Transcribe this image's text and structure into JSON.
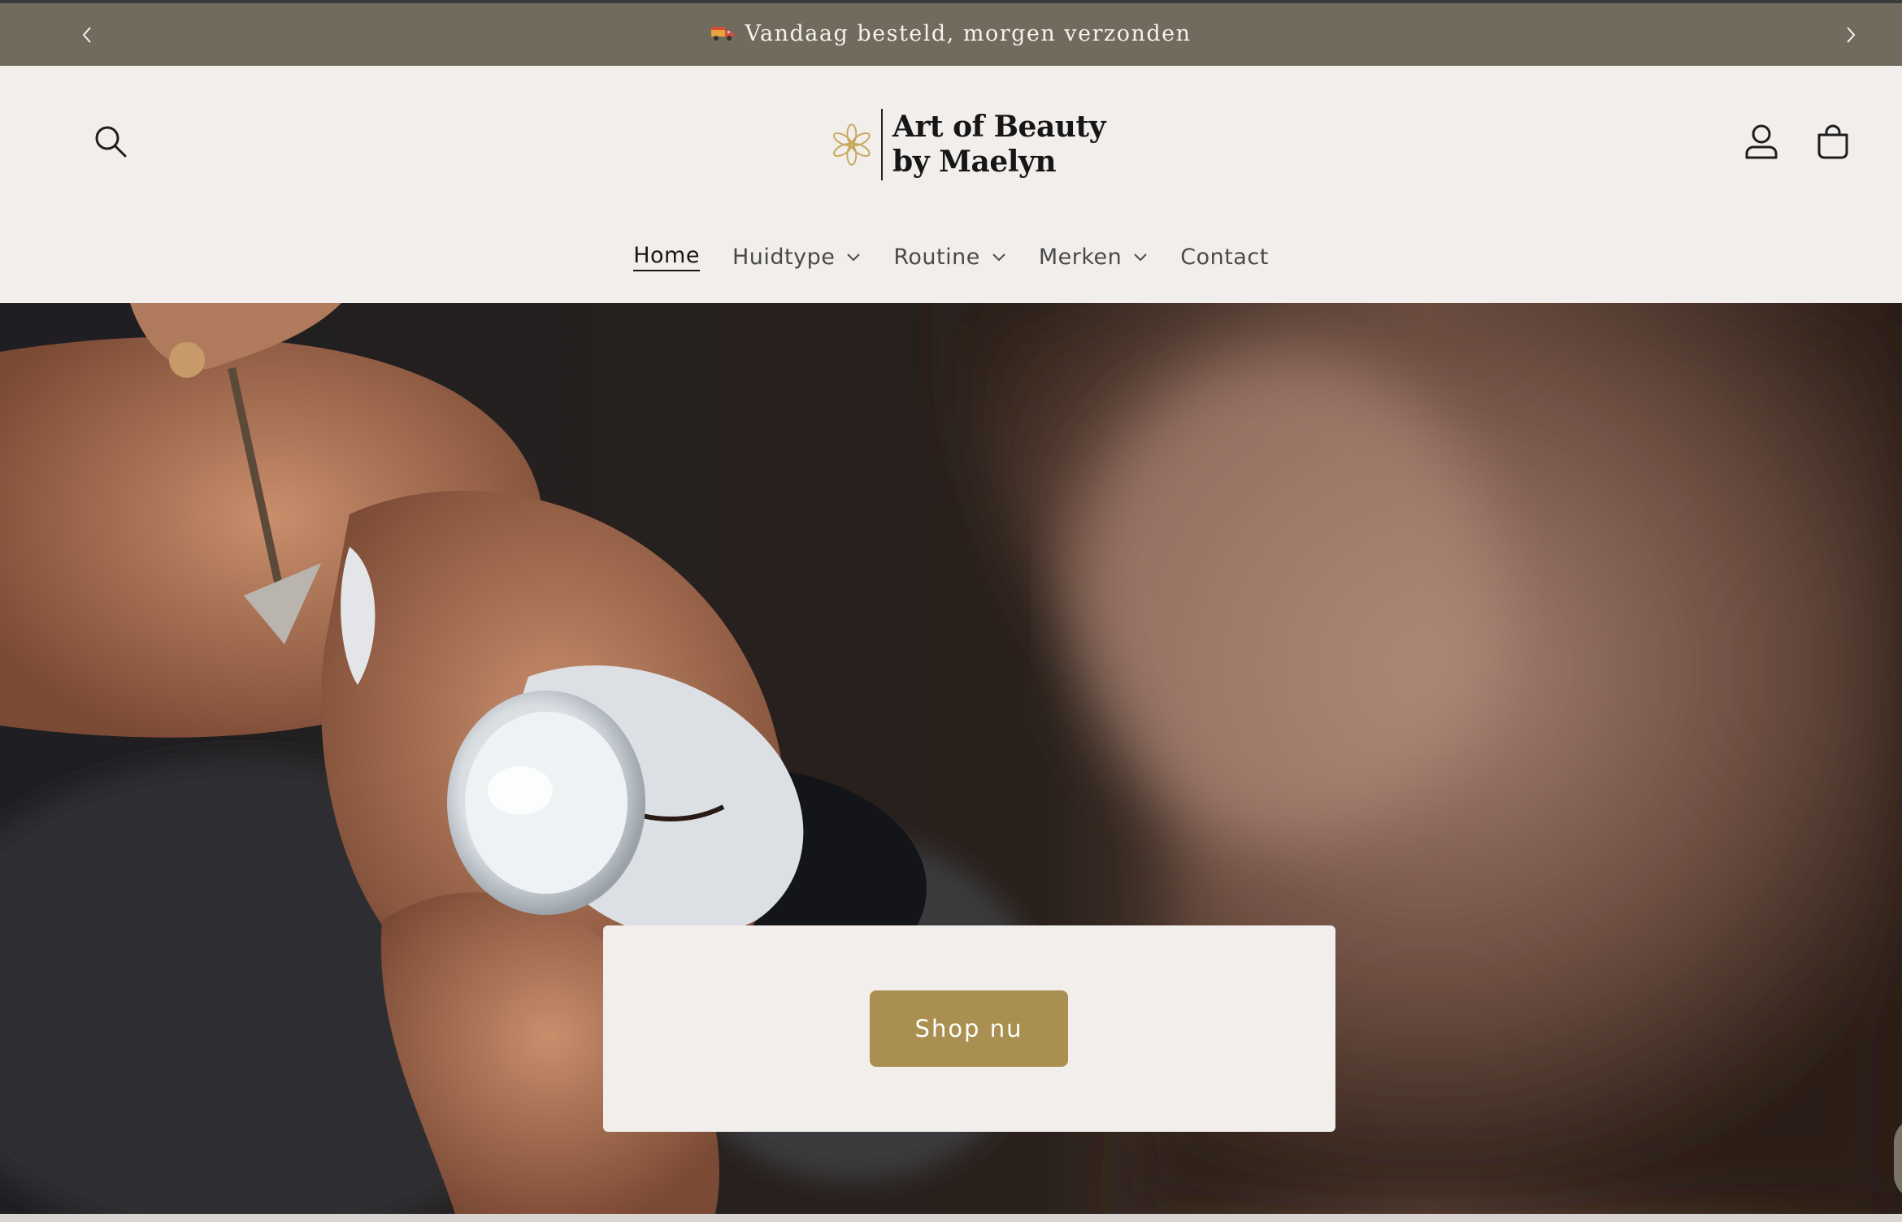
{
  "announcement": {
    "text": "Vandaag besteld, morgen verzonden",
    "icon": "truck-icon"
  },
  "header": {
    "search_icon": "search-icon",
    "account_icon": "account-icon",
    "cart_icon": "cart-icon",
    "logo": {
      "line1": "Art of Beauty",
      "line2": "by Maelyn",
      "mark_icon": "flower-icon"
    }
  },
  "nav": {
    "items": [
      {
        "label": "Home",
        "active": true
      },
      {
        "label": "Huidtype",
        "dropdown": true
      },
      {
        "label": "Routine",
        "dropdown": true
      },
      {
        "label": "Merken",
        "dropdown": true
      },
      {
        "label": "Contact"
      }
    ]
  },
  "hero": {
    "cta_label": "Shop nu"
  },
  "colors": {
    "announcement_bg": "#716b5d",
    "page_bg": "#f1eeec",
    "accent_gold": "#a99050",
    "logo_gold": "#c7a95b"
  }
}
